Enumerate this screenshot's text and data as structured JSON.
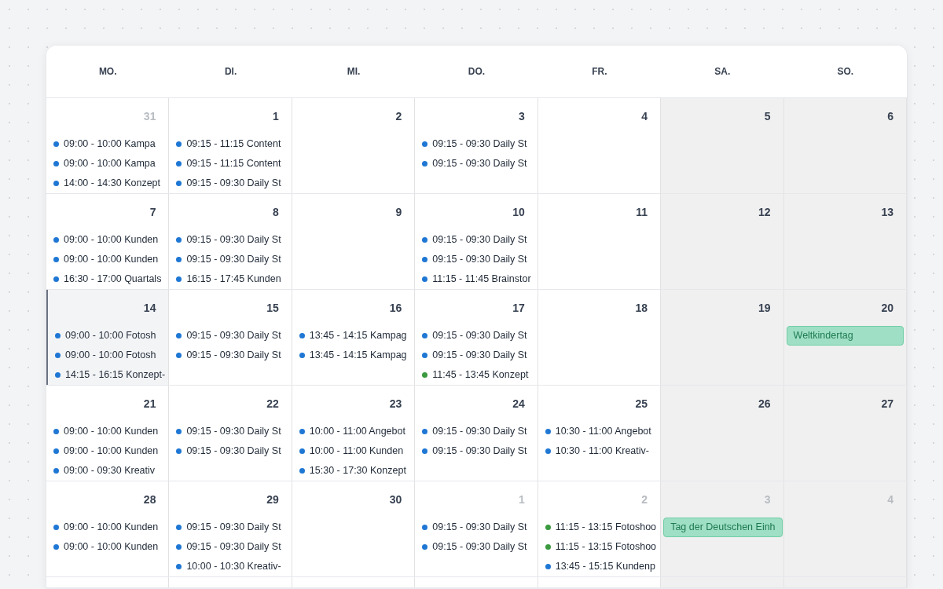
{
  "weekdays": [
    {
      "label": "MO."
    },
    {
      "label": "DI."
    },
    {
      "label": "MI."
    },
    {
      "label": "DO."
    },
    {
      "label": "FR."
    },
    {
      "label": "SA."
    },
    {
      "label": "SO."
    }
  ],
  "weeks": [
    {
      "days": [
        {
          "day": "31",
          "outside_month": true,
          "selected": false,
          "weekend": false,
          "events": [
            {
              "kind": "event",
              "color": "#1f77d4",
              "text": "09:00 - 10:00 Kampa"
            },
            {
              "kind": "event",
              "color": "#1f77d4",
              "text": "09:00 - 10:00 Kampa"
            },
            {
              "kind": "event",
              "color": "#1f77d4",
              "text": "14:00 - 14:30 Konzept"
            }
          ]
        },
        {
          "day": "1",
          "outside_month": false,
          "selected": false,
          "weekend": false,
          "events": [
            {
              "kind": "event",
              "color": "#1f77d4",
              "text": "09:15 - 11:15 Content"
            },
            {
              "kind": "event",
              "color": "#1f77d4",
              "text": "09:15 - 11:15 Content"
            },
            {
              "kind": "event",
              "color": "#1f77d4",
              "text": "09:15 - 09:30 Daily St"
            }
          ]
        },
        {
          "day": "2",
          "outside_month": false,
          "selected": false,
          "weekend": false
        },
        {
          "day": "3",
          "outside_month": false,
          "selected": false,
          "weekend": false,
          "events": [
            {
              "kind": "event",
              "color": "#1f77d4",
              "text": "09:15 - 09:30 Daily St"
            },
            {
              "kind": "event",
              "color": "#1f77d4",
              "text": "09:15 - 09:30 Daily St"
            }
          ]
        },
        {
          "day": "4",
          "outside_month": false,
          "selected": false,
          "weekend": false
        },
        {
          "day": "5",
          "outside_month": false,
          "selected": false,
          "weekend": true
        },
        {
          "day": "6",
          "outside_month": false,
          "selected": false,
          "weekend": true
        }
      ]
    },
    {
      "days": [
        {
          "day": "7",
          "outside_month": false,
          "selected": false,
          "weekend": false,
          "events": [
            {
              "kind": "event",
              "color": "#1f77d4",
              "text": "09:00 - 10:00 Kunden"
            },
            {
              "kind": "event",
              "color": "#1f77d4",
              "text": "09:00 - 10:00 Kunden"
            },
            {
              "kind": "event",
              "color": "#1f77d4",
              "text": "16:30 - 17:00 Quartals"
            }
          ]
        },
        {
          "day": "8",
          "outside_month": false,
          "selected": false,
          "weekend": false,
          "events": [
            {
              "kind": "event",
              "color": "#1f77d4",
              "text": "09:15 - 09:30 Daily St"
            },
            {
              "kind": "event",
              "color": "#1f77d4",
              "text": "09:15 - 09:30 Daily St"
            },
            {
              "kind": "event",
              "color": "#1f77d4",
              "text": "16:15 - 17:45 Kunden"
            }
          ]
        },
        {
          "day": "9",
          "outside_month": false,
          "selected": false,
          "weekend": false
        },
        {
          "day": "10",
          "outside_month": false,
          "selected": false,
          "weekend": false,
          "events": [
            {
              "kind": "event",
              "color": "#1f77d4",
              "text": "09:15 - 09:30 Daily St"
            },
            {
              "kind": "event",
              "color": "#1f77d4",
              "text": "09:15 - 09:30 Daily St"
            },
            {
              "kind": "event",
              "color": "#1f77d4",
              "text": "11:15 - 11:45 Brainstor"
            }
          ]
        },
        {
          "day": "11",
          "outside_month": false,
          "selected": false,
          "weekend": false
        },
        {
          "day": "12",
          "outside_month": false,
          "selected": false,
          "weekend": true
        },
        {
          "day": "13",
          "outside_month": false,
          "selected": false,
          "weekend": true
        }
      ]
    },
    {
      "days": [
        {
          "day": "14",
          "outside_month": false,
          "selected": true,
          "weekend": false,
          "events": [
            {
              "kind": "event",
              "color": "#1f77d4",
              "text": "09:00 - 10:00 Fotosh"
            },
            {
              "kind": "event",
              "color": "#1f77d4",
              "text": "09:00 - 10:00 Fotosh"
            },
            {
              "kind": "event",
              "color": "#1f77d4",
              "text": "14:15 - 16:15 Konzept-"
            }
          ]
        },
        {
          "day": "15",
          "outside_month": false,
          "selected": false,
          "weekend": false,
          "events": [
            {
              "kind": "event",
              "color": "#1f77d4",
              "text": "09:15 - 09:30 Daily St"
            },
            {
              "kind": "event",
              "color": "#1f77d4",
              "text": "09:15 - 09:30 Daily St"
            }
          ]
        },
        {
          "day": "16",
          "outside_month": false,
          "selected": false,
          "weekend": false,
          "events": [
            {
              "kind": "event",
              "color": "#1f77d4",
              "text": "13:45 - 14:15 Kampag"
            },
            {
              "kind": "event",
              "color": "#1f77d4",
              "text": "13:45 - 14:15 Kampag"
            }
          ]
        },
        {
          "day": "17",
          "outside_month": false,
          "selected": false,
          "weekend": false,
          "events": [
            {
              "kind": "event",
              "color": "#1f77d4",
              "text": "09:15 - 09:30 Daily St"
            },
            {
              "kind": "event",
              "color": "#1f77d4",
              "text": "09:15 - 09:30 Daily St"
            },
            {
              "kind": "event",
              "color": "#3b9a3f",
              "text": "11:45 - 13:45 Konzept"
            }
          ]
        },
        {
          "day": "18",
          "outside_month": false,
          "selected": false,
          "weekend": false
        },
        {
          "day": "19",
          "outside_month": false,
          "selected": false,
          "weekend": true
        },
        {
          "day": "20",
          "outside_month": false,
          "selected": false,
          "weekend": true,
          "events": [
            {
              "kind": "holiday",
              "text": "Weltkindertag"
            }
          ]
        }
      ]
    },
    {
      "days": [
        {
          "day": "21",
          "outside_month": false,
          "selected": false,
          "weekend": false,
          "events": [
            {
              "kind": "event",
              "color": "#1f77d4",
              "text": "09:00 - 10:00 Kunden"
            },
            {
              "kind": "event",
              "color": "#1f77d4",
              "text": "09:00 - 10:00 Kunden"
            },
            {
              "kind": "event",
              "color": "#1f77d4",
              "text": "09:00 - 09:30 Kreativ"
            }
          ]
        },
        {
          "day": "22",
          "outside_month": false,
          "selected": false,
          "weekend": false,
          "events": [
            {
              "kind": "event",
              "color": "#1f77d4",
              "text": "09:15 - 09:30 Daily St"
            },
            {
              "kind": "event",
              "color": "#1f77d4",
              "text": "09:15 - 09:30 Daily St"
            }
          ]
        },
        {
          "day": "23",
          "outside_month": false,
          "selected": false,
          "weekend": false,
          "events": [
            {
              "kind": "event",
              "color": "#1f77d4",
              "text": "10:00 - 11:00 Angebot"
            },
            {
              "kind": "event",
              "color": "#1f77d4",
              "text": "10:00 - 11:00 Kunden"
            },
            {
              "kind": "event",
              "color": "#1f77d4",
              "text": "15:30 - 17:30 Konzept"
            }
          ]
        },
        {
          "day": "24",
          "outside_month": false,
          "selected": false,
          "weekend": false,
          "events": [
            {
              "kind": "event",
              "color": "#1f77d4",
              "text": "09:15 - 09:30 Daily St"
            },
            {
              "kind": "event",
              "color": "#1f77d4",
              "text": "09:15 - 09:30 Daily St"
            }
          ]
        },
        {
          "day": "25",
          "outside_month": false,
          "selected": false,
          "weekend": false,
          "events": [
            {
              "kind": "event",
              "color": "#1f77d4",
              "text": "10:30 - 11:00 Angebot"
            },
            {
              "kind": "event",
              "color": "#1f77d4",
              "text": "10:30 - 11:00 Kreativ-"
            }
          ]
        },
        {
          "day": "26",
          "outside_month": false,
          "selected": false,
          "weekend": true
        },
        {
          "day": "27",
          "outside_month": false,
          "selected": false,
          "weekend": true
        }
      ]
    },
    {
      "days": [
        {
          "day": "28",
          "outside_month": false,
          "selected": false,
          "weekend": false,
          "events": [
            {
              "kind": "event",
              "color": "#1f77d4",
              "text": "09:00 - 10:00 Kunden"
            },
            {
              "kind": "event",
              "color": "#1f77d4",
              "text": "09:00 - 10:00 Kunden"
            }
          ]
        },
        {
          "day": "29",
          "outside_month": false,
          "selected": false,
          "weekend": false,
          "events": [
            {
              "kind": "event",
              "color": "#1f77d4",
              "text": "09:15 - 09:30 Daily St"
            },
            {
              "kind": "event",
              "color": "#1f77d4",
              "text": "09:15 - 09:30 Daily St"
            },
            {
              "kind": "event",
              "color": "#1f77d4",
              "text": "10:00 - 10:30 Kreativ-"
            }
          ]
        },
        {
          "day": "30",
          "outside_month": false,
          "selected": false,
          "weekend": false
        },
        {
          "day": "1",
          "outside_month": true,
          "selected": false,
          "weekend": false,
          "events": [
            {
              "kind": "event",
              "color": "#1f77d4",
              "text": "09:15 - 09:30 Daily St"
            },
            {
              "kind": "event",
              "color": "#1f77d4",
              "text": "09:15 - 09:30 Daily St"
            }
          ]
        },
        {
          "day": "2",
          "outside_month": true,
          "selected": false,
          "weekend": false,
          "events": [
            {
              "kind": "event",
              "color": "#3b9a3f",
              "text": "11:15 - 13:15 Fotoshoo"
            },
            {
              "kind": "event",
              "color": "#3b9a3f",
              "text": "11:15 - 13:15 Fotoshoo"
            },
            {
              "kind": "event",
              "color": "#1f77d4",
              "text": "13:45 - 15:15 Kundenp"
            }
          ]
        },
        {
          "day": "3",
          "outside_month": true,
          "selected": false,
          "weekend": true,
          "events": [
            {
              "kind": "holiday",
              "text": "Tag der Deutschen Einh"
            }
          ]
        },
        {
          "day": "4",
          "outside_month": true,
          "selected": false,
          "weekend": true
        }
      ]
    }
  ]
}
